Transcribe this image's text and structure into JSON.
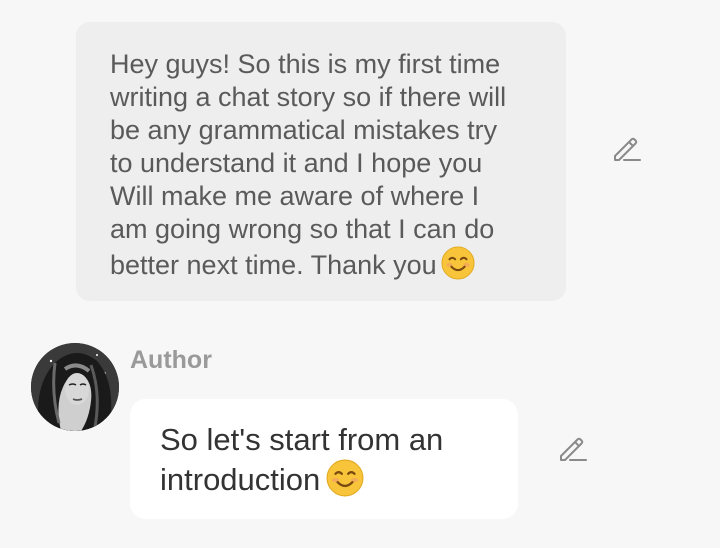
{
  "narration": {
    "text": "Hey guys! So this is my first time\nwriting a chat story so if there will\nbe any grammatical mistakes try\nto understand it and I hope you\nWill make me aware of where I\nam going wrong so that I can do\nbetter next time. Thank you",
    "emoji_icon": "smiling-face-emoji"
  },
  "message": {
    "author": "Author",
    "text": "So let's start from an\nintroduction",
    "emoji_icon": "smiling-face-emoji"
  },
  "icons": {
    "edit": "pencil-edit-icon"
  },
  "colors": {
    "background": "#f7f7f7",
    "narration_bubble": "#eeeeee",
    "message_bubble": "#ffffff",
    "author_label": "#9a9a9a",
    "emoji": "#f8c53a"
  }
}
